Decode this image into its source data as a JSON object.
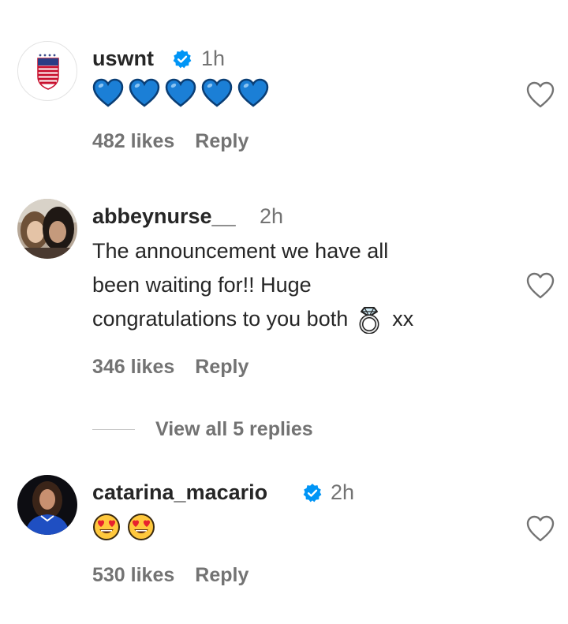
{
  "comments": [
    {
      "username": "uswnt",
      "verified": true,
      "time": "1h",
      "body_emoji": [
        "blue-heart",
        "blue-heart",
        "blue-heart",
        "blue-heart",
        "blue-heart"
      ],
      "likes": "482 likes",
      "reply": "Reply"
    },
    {
      "username": "abbeynurse__",
      "verified": false,
      "time": "2h",
      "body_line1": "The announcement we have all",
      "body_line2": "been waiting for!! Huge",
      "body_line3": "congratulations to you both",
      "body_suffix": "xx",
      "body_emoji": [
        "ring"
      ],
      "likes": "346 likes",
      "reply": "Reply",
      "view_replies": "View all 5 replies"
    },
    {
      "username": "catarina_macario",
      "verified": true,
      "time": "2h",
      "body_emoji": [
        "heart-eyes-face",
        "heart-eyes-face"
      ],
      "likes": "530 likes",
      "reply": "Reply"
    }
  ],
  "colors": {
    "verified_blue": "#0095f6",
    "heart_blue": "#1b7fd6",
    "muted_text": "#737373",
    "primary_text": "#262626"
  }
}
